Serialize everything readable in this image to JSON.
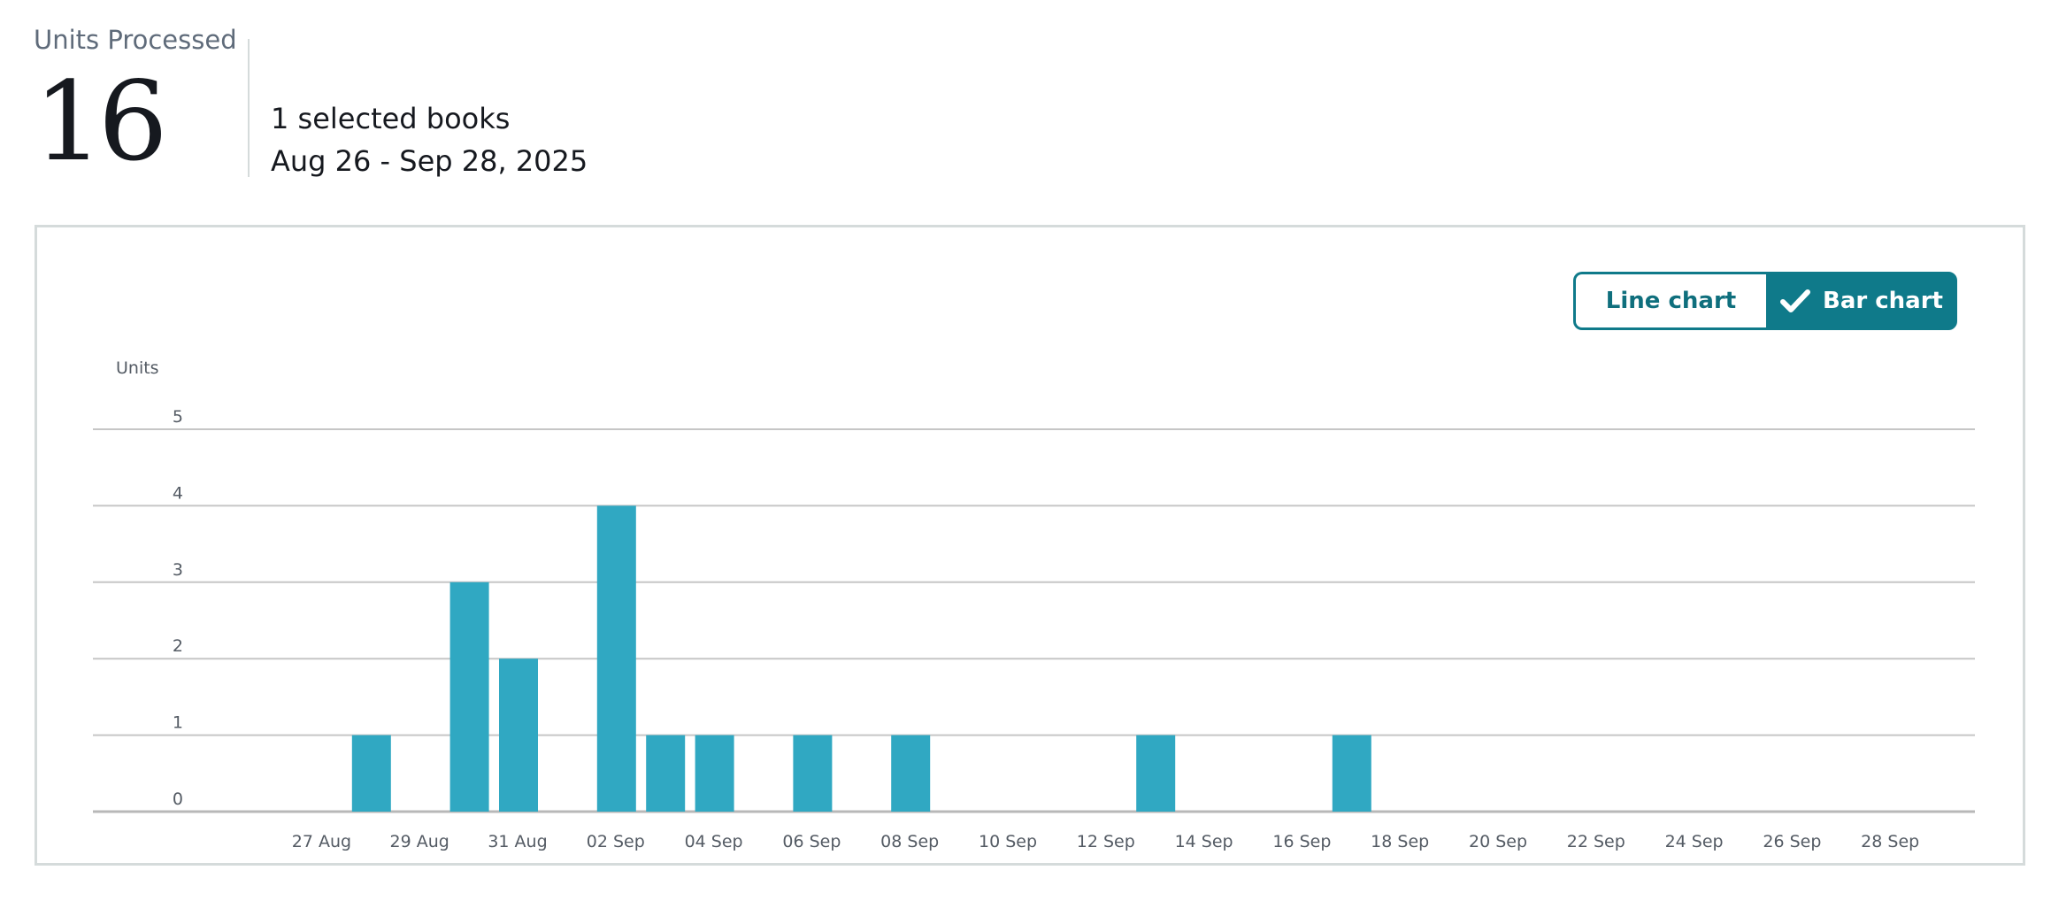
{
  "summary": {
    "label": "Units Processed",
    "value": "16",
    "selection": "1 selected books",
    "date_range": "Aug 26 - Sep 28, 2025"
  },
  "toggle": {
    "line_label": "Line chart",
    "bar_label": "Bar chart",
    "selected": "bar"
  },
  "colors": {
    "bar": "#30a8c2",
    "accent": "#0f7a8a",
    "grid": "#c6c6c6"
  },
  "chart_data": {
    "type": "bar",
    "ylabel": "Units",
    "ylim": [
      0,
      5
    ],
    "yticks": [
      0,
      1,
      2,
      3,
      4,
      5
    ],
    "grid": true,
    "x": [
      "26 Aug",
      "27 Aug",
      "28 Aug",
      "29 Aug",
      "30 Aug",
      "31 Aug",
      "01 Sep",
      "02 Sep",
      "03 Sep",
      "04 Sep",
      "05 Sep",
      "06 Sep",
      "07 Sep",
      "08 Sep",
      "09 Sep",
      "10 Sep",
      "11 Sep",
      "12 Sep",
      "13 Sep",
      "14 Sep",
      "15 Sep",
      "16 Sep",
      "17 Sep",
      "18 Sep",
      "19 Sep",
      "20 Sep",
      "21 Sep",
      "22 Sep",
      "23 Sep",
      "24 Sep",
      "25 Sep",
      "26 Sep",
      "27 Sep",
      "28 Sep"
    ],
    "values": [
      0,
      0,
      1,
      0,
      3,
      2,
      0,
      4,
      1,
      1,
      0,
      1,
      0,
      1,
      0,
      0,
      0,
      0,
      1,
      0,
      0,
      0,
      1,
      0,
      0,
      0,
      0,
      0,
      0,
      0,
      0,
      0,
      0,
      0
    ],
    "xtick_labels": [
      "27 Aug",
      "29 Aug",
      "31 Aug",
      "02 Sep",
      "04 Sep",
      "06 Sep",
      "08 Sep",
      "10 Sep",
      "12 Sep",
      "14 Sep",
      "16 Sep",
      "18 Sep",
      "20 Sep",
      "22 Sep",
      "24 Sep",
      "26 Sep",
      "28 Sep"
    ]
  }
}
